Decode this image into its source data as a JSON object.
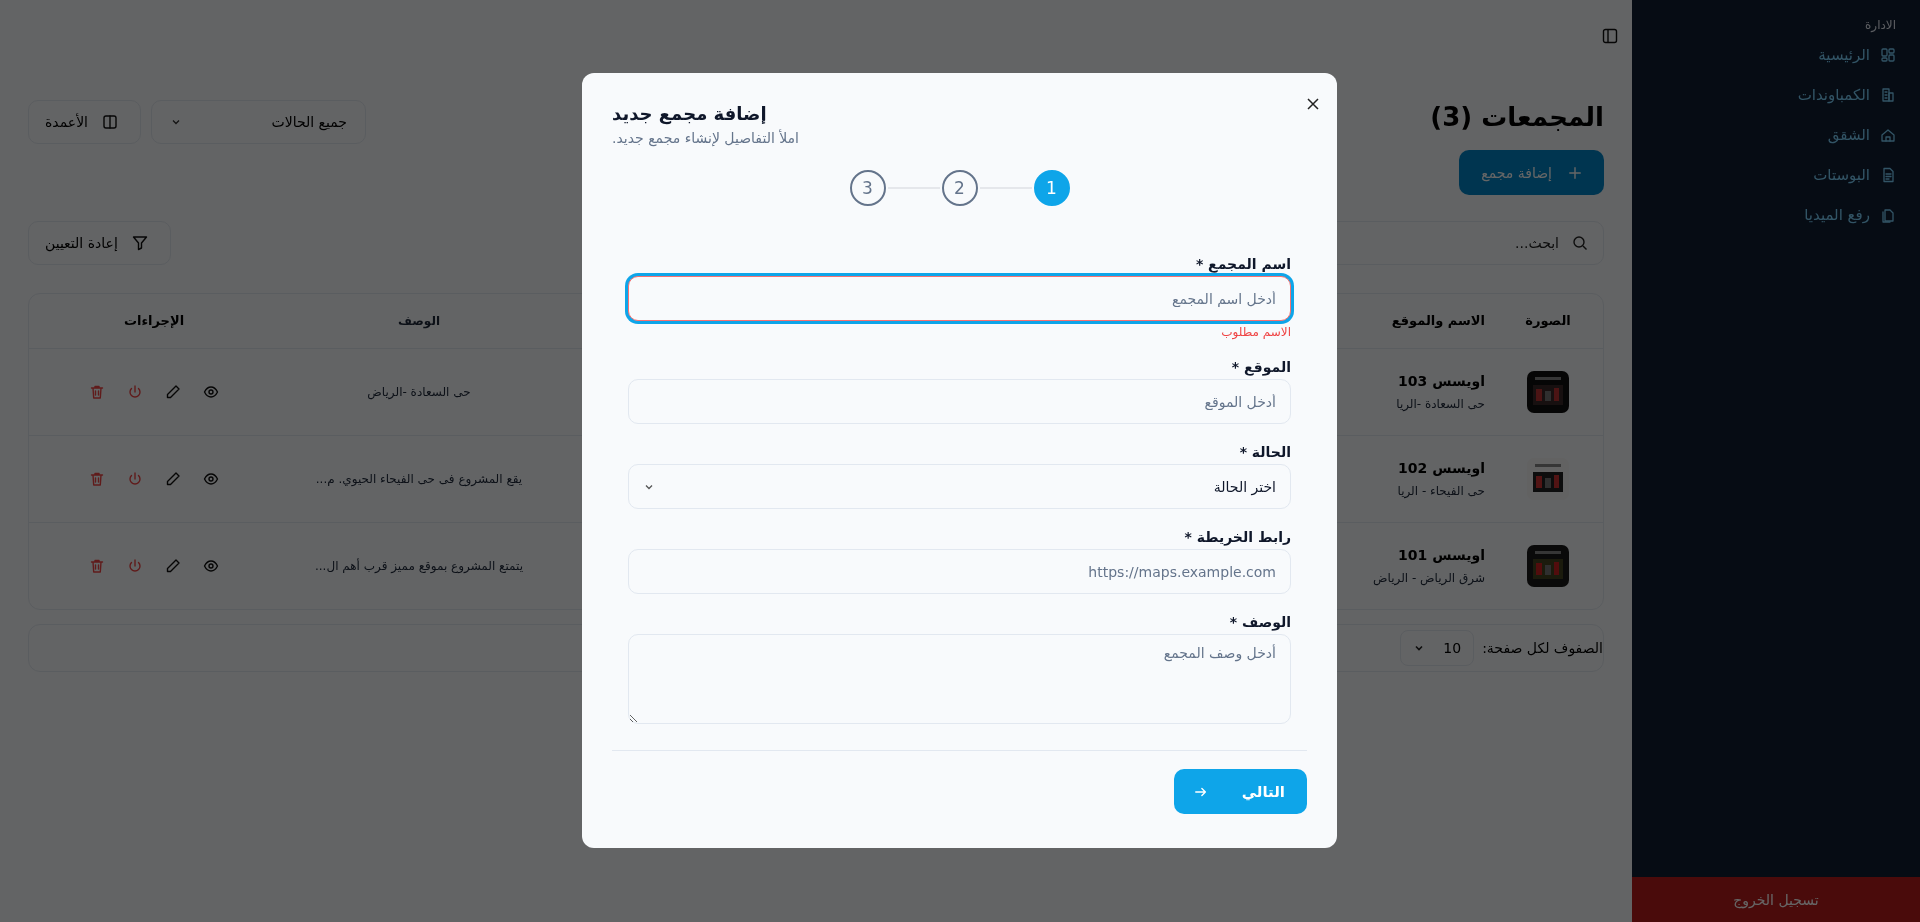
{
  "sidebar": {
    "section_title": "الادارة",
    "items": [
      {
        "label": "الرئيسية"
      },
      {
        "label": "الكمباوندات"
      },
      {
        "label": "الشقق"
      },
      {
        "label": "البوستات"
      },
      {
        "label": "رفع الميديا"
      }
    ],
    "logout_button": "تسجيل الخروج"
  },
  "page": {
    "title": "المجمعات (3)",
    "add_button": "إضافة مجمع",
    "search": {
      "placeholder": "ابحث..."
    },
    "reset_button": "إعادة التعيين",
    "status_filter": {
      "value": "جميع الحالات"
    },
    "columns_button": "الأعمدة"
  },
  "table": {
    "columns": [
      "الصورة",
      "الاسم والموقع",
      "الوصف",
      "الإجراءات"
    ],
    "rows": [
      {
        "name": "اويسس 103",
        "location": "حى السعادة -الريا",
        "description": "حى السعادة -الرياض"
      },
      {
        "name": "اويسس 102",
        "location": "حى الفيحاء - الريا",
        "description": "يقع المشروع فى حى الفيحاء الحيوي. م..."
      },
      {
        "name": "اويسس 101",
        "location": "شرق الرياض - الرياض",
        "description": "يتمتع المشروع بموقع مميز قرب أهم ال..."
      }
    ]
  },
  "pagination": {
    "rows_per_page_label": "الصفوف لكل صفحة:",
    "rows_per_page": "10"
  },
  "dialog": {
    "title": "إضافة مجمع جديد",
    "subtitle": "املأ التفاصيل لإنشاء مجمع جديد.",
    "steps": [
      {
        "label": "1",
        "selected": true
      },
      {
        "label": "2",
        "selected": false
      },
      {
        "label": "3",
        "selected": false
      }
    ],
    "fields": [
      {
        "kind": "text",
        "label": "اسم المجمع *",
        "placeholder": "أدخل اسم المجمع",
        "focused": true,
        "error": "الاسم مطلوب"
      },
      {
        "kind": "text",
        "label": "الموقع *",
        "placeholder": "أدخل الموقع",
        "focused": false
      },
      {
        "kind": "select",
        "label": "الحالة *",
        "value": "اختر الحالة",
        "focused": false
      },
      {
        "kind": "text",
        "label": "رابط الخريطة *",
        "placeholder": "https://maps.example.com",
        "focused": false
      },
      {
        "kind": "textarea",
        "label": "الوصف *",
        "placeholder": "أدخل وصف المجمع",
        "focused": false
      }
    ],
    "next_button": "التالي"
  }
}
